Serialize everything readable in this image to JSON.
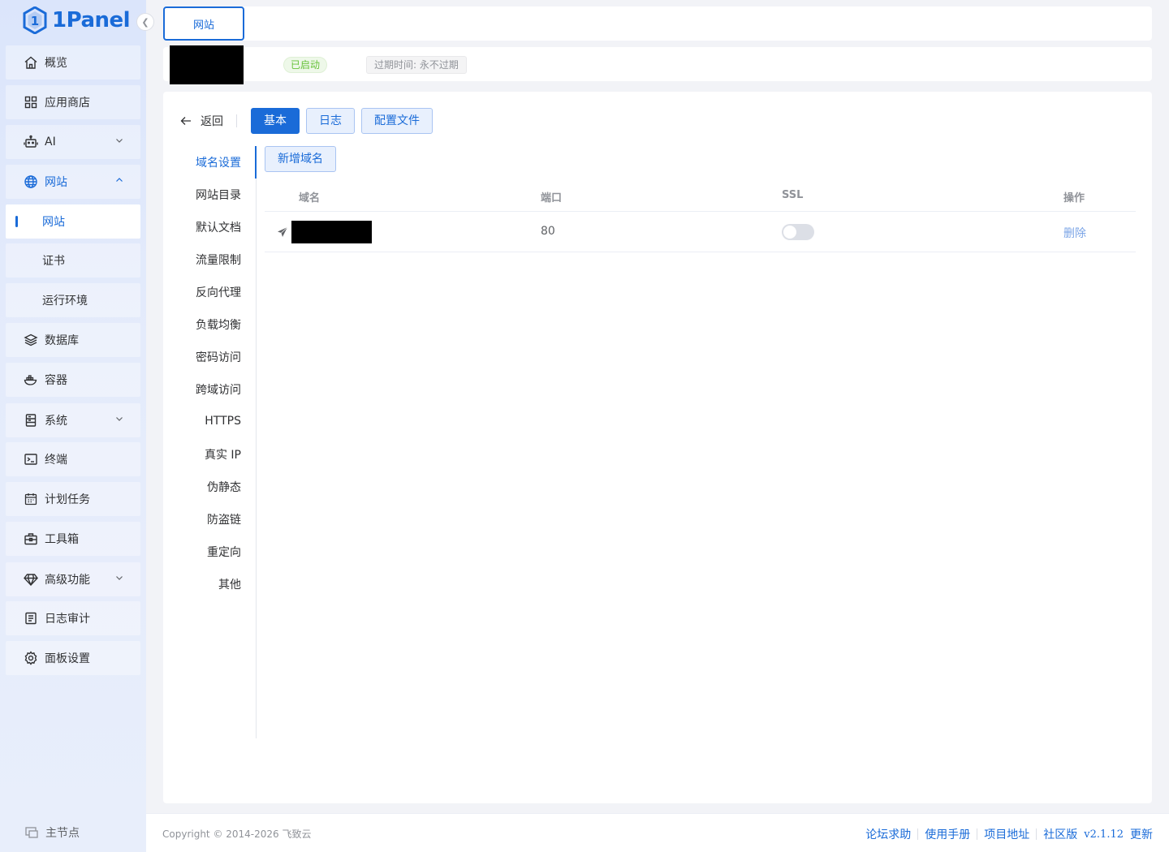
{
  "brand": {
    "name": "1Panel"
  },
  "sidebar": {
    "items": [
      {
        "label": "概览",
        "icon": "home-icon"
      },
      {
        "label": "应用商店",
        "icon": "grid-icon"
      },
      {
        "label": "AI",
        "icon": "robot-icon"
      },
      {
        "label": "网站",
        "icon": "globe-icon",
        "expanded": true
      },
      {
        "label": "网站",
        "sub": true,
        "active": true
      },
      {
        "label": "证书",
        "sub": true
      },
      {
        "label": "运行环境",
        "sub": true
      },
      {
        "label": "数据库",
        "icon": "layers-icon"
      },
      {
        "label": "容器",
        "icon": "docker-icon"
      },
      {
        "label": "系统",
        "icon": "server-icon"
      },
      {
        "label": "终端",
        "icon": "terminal-icon"
      },
      {
        "label": "计划任务",
        "icon": "calendar-icon"
      },
      {
        "label": "工具箱",
        "icon": "toolbox-icon"
      },
      {
        "label": "高级功能",
        "icon": "diamond-icon"
      },
      {
        "label": "日志审计",
        "icon": "log-icon"
      },
      {
        "label": "面板设置",
        "icon": "settings-icon"
      }
    ],
    "node_switch": "主节点"
  },
  "tabbar": {
    "active_tab": "网站"
  },
  "site": {
    "status": "已启动",
    "expire": "过期时间: 永不过期"
  },
  "toolbar": {
    "back": "返回",
    "basic": "基本",
    "log": "日志",
    "config": "配置文件"
  },
  "settings_nav": [
    "域名设置",
    "网站目录",
    "默认文档",
    "流量限制",
    "反向代理",
    "负载均衡",
    "密码访问",
    "跨域访问",
    "HTTPS",
    "真实 IP",
    "伪静态",
    "防盗链",
    "重定向",
    "其他"
  ],
  "domains": {
    "add_button": "新增域名",
    "columns": {
      "domain": "域名",
      "port": "端口",
      "ssl": "SSL",
      "action": "操作"
    },
    "rows": [
      {
        "port": "80",
        "ssl": false,
        "action": "删除"
      }
    ]
  },
  "footer": {
    "copyright": "Copyright © 2014-2026 飞致云",
    "forum": "论坛求助",
    "manual": "使用手册",
    "project": "项目地址",
    "edition": "社区版",
    "version": "v2.1.12",
    "update": "更新"
  },
  "colors": {
    "accent": "#1a6bd8",
    "success": "#67c23a"
  }
}
